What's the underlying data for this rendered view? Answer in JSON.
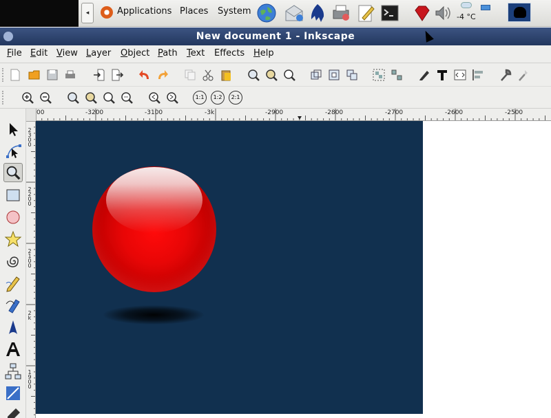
{
  "top_panel": {
    "menus": [
      "Applications",
      "Places",
      "System"
    ],
    "temperature": "-4 °C"
  },
  "window": {
    "title": "New document 1 - Inkscape"
  },
  "menubar": {
    "items": [
      {
        "label": "File",
        "u": "F",
        "rest": "ile"
      },
      {
        "label": "Edit",
        "u": "E",
        "rest": "dit"
      },
      {
        "label": "View",
        "u": "V",
        "rest": "iew"
      },
      {
        "label": "Layer",
        "u": "L",
        "rest": "ayer"
      },
      {
        "label": "Object",
        "u": "O",
        "rest": "bject"
      },
      {
        "label": "Path",
        "u": "P",
        "rest": "ath"
      },
      {
        "label": "Text",
        "u": "T",
        "rest": "ext"
      },
      {
        "label": "Effects",
        "u": "",
        "rest": "Effects"
      },
      {
        "label": "Help",
        "u": "H",
        "rest": "elp"
      }
    ]
  },
  "ruler": {
    "h_labels": [
      "00",
      "-3200",
      "-3100",
      "-3k",
      "-2900",
      "-2800",
      "-2700",
      "-2600",
      "-2500"
    ],
    "v_labels": [
      "2\n3\n0\n0",
      "2\n2\n0\n0",
      "2\n1\n0\n0",
      "2\nk",
      "1\n9\n0\n0"
    ]
  },
  "toolbar2_labels": {
    "zoom_1_1": "1:1",
    "zoom_1_2": "1:2",
    "zoom_2_1": "2:1"
  },
  "colors": {
    "page_background": "#11304f",
    "sphere": "#e80606",
    "titlebar": "#2f4672"
  }
}
